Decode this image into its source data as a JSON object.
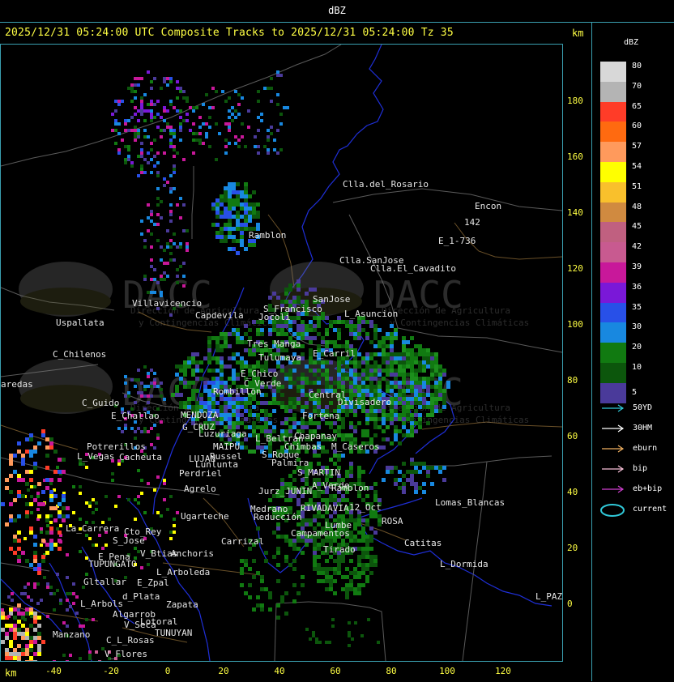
{
  "window": {
    "title": "dBZ"
  },
  "header": {
    "title": "2025/12/31 05:24:00 UTC Composite Tracks to 2025/12/31 05:24:00 Tz 35",
    "unit": "km"
  },
  "axes": {
    "x_unit": "km",
    "x_ticks": [
      "-40",
      "-20",
      "0",
      "20",
      "40",
      "60",
      "80",
      "100",
      "120"
    ],
    "y_ticks": [
      "180",
      "160",
      "140",
      "120",
      "100",
      "80",
      "60",
      "40",
      "20",
      "0"
    ]
  },
  "legend": {
    "title": "dBZ",
    "levels": [
      {
        "label": "80",
        "color": "#d8d8d8"
      },
      {
        "label": "70",
        "color": "#b4b4b4"
      },
      {
        "label": "65",
        "color": "#ff3c28"
      },
      {
        "label": "60",
        "color": "#ff6a10"
      },
      {
        "label": "57",
        "color": "#ff9a5c"
      },
      {
        "label": "54",
        "color": "#ffff00"
      },
      {
        "label": "51",
        "color": "#f9c02c"
      },
      {
        "label": "48",
        "color": "#d08a40"
      },
      {
        "label": "45",
        "color": "#c06080"
      },
      {
        "label": "42",
        "color": "#c85a90"
      },
      {
        "label": "39",
        "color": "#c8189a"
      },
      {
        "label": "36",
        "color": "#7a18d8"
      },
      {
        "label": "35",
        "color": "#2850e8"
      },
      {
        "label": "30",
        "color": "#1888e0"
      },
      {
        "label": "20",
        "color": "#117a11"
      },
      {
        "label": "10",
        "color": "#0c560c"
      },
      {
        "label": "5",
        "color": "#4a3a9a"
      }
    ]
  },
  "tracks": [
    {
      "label": "50YD",
      "color": "#30c8d8"
    },
    {
      "label": "30HM",
      "color": "#ffffff"
    },
    {
      "label": "eburn",
      "color": "#f0b060"
    },
    {
      "label": "bip",
      "color": "#f8c0d8"
    },
    {
      "label": "eb+bip",
      "color": "#d040d0"
    },
    {
      "label": "current",
      "color": "#30c8d8"
    }
  ],
  "watermark": {
    "brand": "DACC",
    "line1": "Dirección de Agricultura",
    "line2": "y Contingencias Climáticas"
  },
  "places": [
    {
      "name": "Clla.del_Rosario"
    },
    {
      "name": "Encon"
    },
    {
      "name": "142"
    },
    {
      "name": "E_1-736"
    },
    {
      "name": "Ramblon"
    },
    {
      "name": "Clla.SanJose"
    },
    {
      "name": "Clla.El_Cavadito"
    },
    {
      "name": "Villavicencio"
    },
    {
      "name": "Uspallata"
    },
    {
      "name": "Capdevila"
    },
    {
      "name": "S_Francisco"
    },
    {
      "name": "Jocoli"
    },
    {
      "name": "SanJose"
    },
    {
      "name": "L_Asuncion"
    },
    {
      "name": "C_Chilenos"
    },
    {
      "name": "aredas"
    },
    {
      "name": "Tres_Manga"
    },
    {
      "name": "E_Carril"
    },
    {
      "name": "Tulumaya"
    },
    {
      "name": "E_Chico"
    },
    {
      "name": "C_Verde"
    },
    {
      "name": "Rombillon"
    },
    {
      "name": "Central"
    },
    {
      "name": "Divisadero"
    },
    {
      "name": "C_Guido"
    },
    {
      "name": "E_Challao"
    },
    {
      "name": "MENDOZA"
    },
    {
      "name": "G_CRUZ"
    },
    {
      "name": "Luzuriaga"
    },
    {
      "name": "Fortena"
    },
    {
      "name": "L_Beltran"
    },
    {
      "name": "Chapanay"
    },
    {
      "name": "Chimbas"
    },
    {
      "name": "M_Caseros"
    },
    {
      "name": "Potrerillos"
    },
    {
      "name": "L_Vegas"
    },
    {
      "name": "Cacheuta"
    },
    {
      "name": "MAIPU"
    },
    {
      "name": "Russel"
    },
    {
      "name": "LUJAN"
    },
    {
      "name": "Lunlunta"
    },
    {
      "name": "S_Roque"
    },
    {
      "name": "Palmira"
    },
    {
      "name": "S_MARTIN"
    },
    {
      "name": "Perdriel"
    },
    {
      "name": "A_Verde"
    },
    {
      "name": "Ramblon"
    },
    {
      "name": "Agrelo"
    },
    {
      "name": "Jurz_JUNIN"
    },
    {
      "name": "Medrano"
    },
    {
      "name": "RIVADAVIA"
    },
    {
      "name": "Reducción"
    },
    {
      "name": "Ugarteche"
    },
    {
      "name": "12_Oct"
    },
    {
      "name": "Lomas_Blancas"
    },
    {
      "name": "ROSA"
    },
    {
      "name": "La_Carrera"
    },
    {
      "name": "Cto_Rey"
    },
    {
      "name": "S_Jose"
    },
    {
      "name": "Carrizal"
    },
    {
      "name": "Catitas"
    },
    {
      "name": "E_Pena"
    },
    {
      "name": "V_Btias"
    },
    {
      "name": "Anchoris"
    },
    {
      "name": "TUPUNGATO"
    },
    {
      "name": "L_Arboleda"
    },
    {
      "name": "L_Dormida"
    },
    {
      "name": "Gltallar"
    },
    {
      "name": "E_Zpal"
    },
    {
      "name": "d_Plata"
    },
    {
      "name": "L_Arbols"
    },
    {
      "name": "Zapata"
    },
    {
      "name": "Algarrob"
    },
    {
      "name": "V_Seca"
    },
    {
      "name": "Lotoral"
    },
    {
      "name": "TUNUYAN"
    },
    {
      "name": "Manzano"
    },
    {
      "name": "C_L_Rosas"
    },
    {
      "name": "V_Flores"
    },
    {
      "name": "L_PAZ"
    },
    {
      "name": "Tirado"
    },
    {
      "name": "Campamentos"
    },
    {
      "name": "Lumbe"
    }
  ]
}
